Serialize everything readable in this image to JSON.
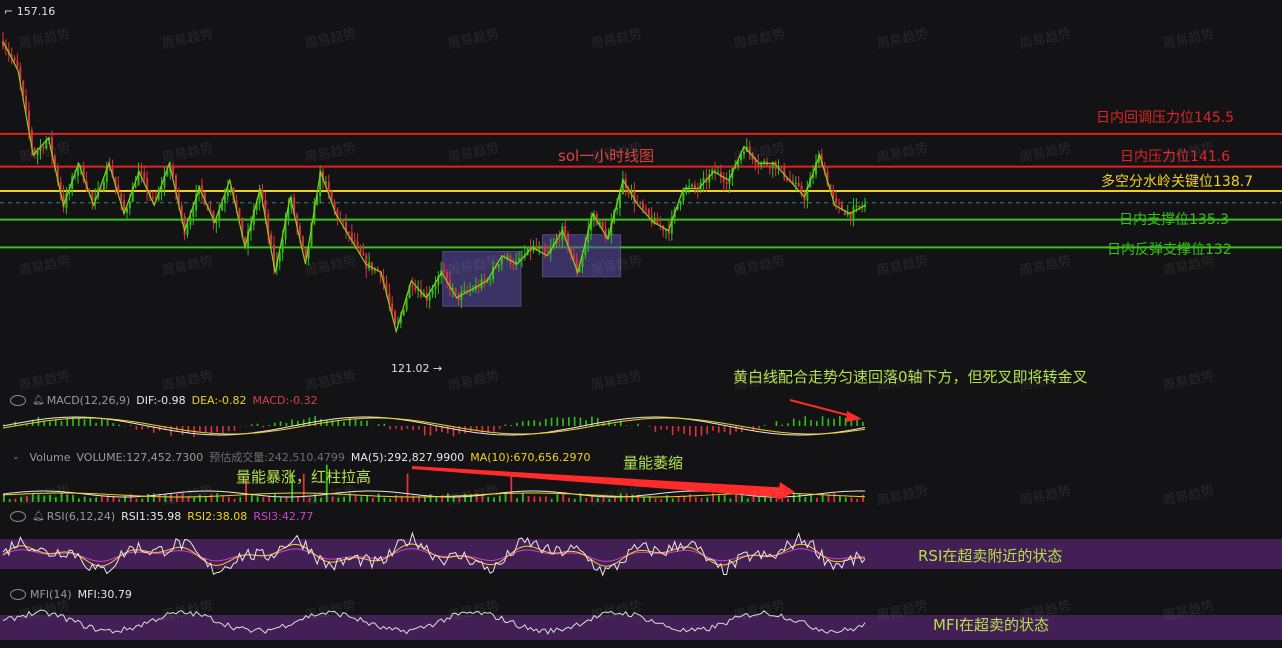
{
  "chart_data": [
    {
      "type": "candlestick",
      "title": "sol一小时线图",
      "y_max_label": "157.16",
      "y_min_label": "121.02",
      "ylim": [
        118,
        160
      ],
      "levels": [
        {
          "label": "日内回调压力位145.5",
          "value": 145.5,
          "color": "#e02424"
        },
        {
          "label": "日内压力位141.6",
          "value": 141.6,
          "color": "#e02424"
        },
        {
          "label": "多空分水岭关键位138.7",
          "value": 138.7,
          "color": "#f0d020"
        },
        {
          "label": "日内支撑位135.3",
          "value": 135.3,
          "color": "#39c21c"
        },
        {
          "label": "日内反弹支撑位132",
          "value": 132,
          "color": "#39c21c"
        }
      ],
      "dashed_level": 137.3,
      "zigzag": [
        156.5,
        153,
        143,
        145,
        137,
        142,
        137,
        142,
        136,
        141,
        137,
        142,
        134,
        139,
        135,
        140,
        132,
        139,
        129,
        138,
        130,
        141,
        136,
        133,
        130,
        129,
        122,
        128,
        126,
        129,
        126,
        127,
        128,
        131,
        130,
        132,
        131,
        134,
        129,
        136,
        133,
        140,
        137,
        135,
        134,
        139,
        139,
        141,
        140,
        144,
        142,
        142,
        140,
        138,
        143,
        137,
        136,
        137
      ],
      "ranges": [
        {
          "from": 0.51,
          "to": 0.6,
          "high": 131.5,
          "low": 125
        },
        {
          "from": 0.625,
          "to": 0.715,
          "high": 133.5,
          "low": 128.5
        }
      ]
    },
    {
      "type": "macd",
      "label": "MACD(12,26,9)",
      "dif_label": "DIF:-0.98",
      "dea_label": "DEA:-0.82",
      "macd_label": "MACD:-0.32"
    },
    {
      "type": "volume",
      "label": "Volume",
      "volume_label": "VOLUME:127,452.7300",
      "est_label": "预估成交量:242,510.4799",
      "ma5_label": "MA(5):292,827.9900",
      "ma10_label": "MA(10):670,656.2970"
    },
    {
      "type": "rsi",
      "label": "RSI(6,12,24)",
      "rsi1_label": "RSI1:35.98",
      "rsi2_label": "RSI2:38.08",
      "rsi3_label": "RSI3:42.77"
    },
    {
      "type": "mfi",
      "label": "MFI(14)",
      "mfi_label": "MFI:30.79"
    }
  ],
  "annotations": {
    "macd_note": "黄白线配合走势匀速回落0轴下方，但死叉即将转金叉",
    "volume_spike_note": "量能暴涨，红柱拉高",
    "volume_shrink_note": "量能萎缩",
    "rsi_note": "RSI在超卖附近的状态",
    "mfi_note": "MFI在超卖的状态"
  },
  "watermark": "周易趋势",
  "colors": {
    "bg": "#131315",
    "up": "#2fc01a",
    "down": "#e0323c",
    "yellow": "#f0d020",
    "purple": "#6a2a8a",
    "arrow": "#ff2a2a"
  }
}
